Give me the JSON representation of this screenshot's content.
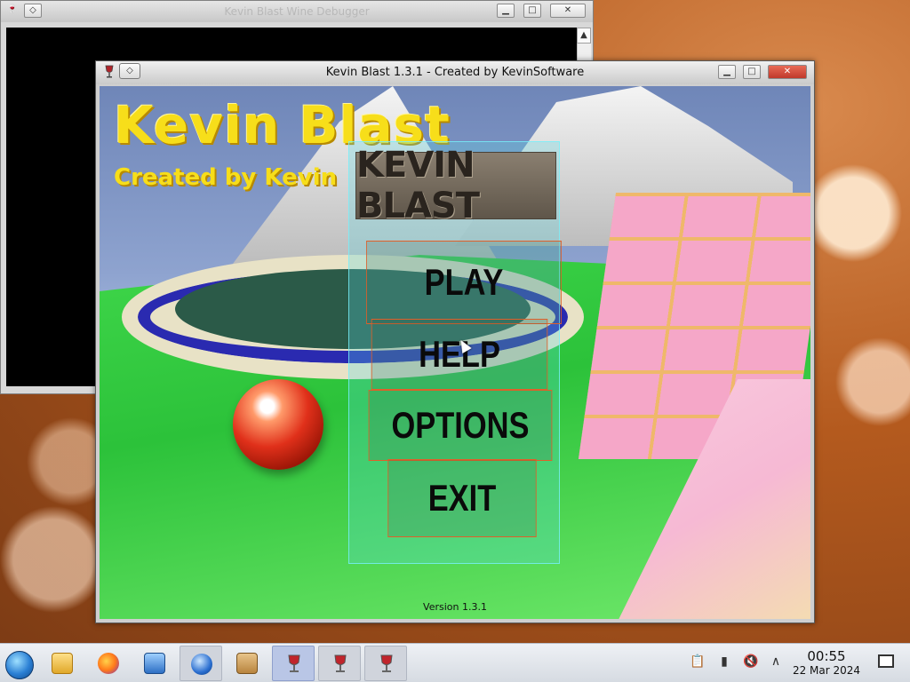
{
  "background_window": {
    "title": "Kevin Blast Wine Debugger",
    "scroll_up_glyph": "▲"
  },
  "main_window": {
    "title": "Kevin Blast 1.3.1 - Created by KevinSoftware",
    "menu_glyph": "◇",
    "minimize_glyph": "▁",
    "maximize_glyph": "□",
    "close_glyph": "✕"
  },
  "game": {
    "logo_title": "Kevin Blast",
    "logo_subtitle": "Created by Kevin",
    "menu_logo": "KEVIN BLAST",
    "menu": {
      "play": "PLAY",
      "help": "HELP",
      "options": "OPTIONS",
      "exit": "EXIT"
    },
    "version": "Version 1.3.1"
  },
  "taskbar": {
    "items": [
      {
        "name": "start-button",
        "icon": "start-orb"
      },
      {
        "name": "file-manager",
        "icon": "folder-icon"
      },
      {
        "name": "firefox",
        "icon": "firefox-icon"
      },
      {
        "name": "control-panel",
        "icon": "control-panel-icon"
      },
      {
        "name": "kevin-blast-installer",
        "icon": "globe-icon"
      },
      {
        "name": "package-manager",
        "icon": "package-icon"
      },
      {
        "name": "wine-app-1",
        "icon": "wine-glass-icon"
      },
      {
        "name": "wine-app-2",
        "icon": "wine-glass-icon"
      },
      {
        "name": "wine-app-3",
        "icon": "wine-glass-icon"
      }
    ],
    "tray": {
      "clock_time": "00:55",
      "clock_date": "22 Mar 2024"
    }
  },
  "colors": {
    "logo_yellow": "#f7de1a",
    "menu_border": "#e0602a",
    "menu_panel_border": "#78f0fa",
    "ball_red": "#e0301a",
    "grass_green": "#2cc23a",
    "tile_pink": "#f5a7c8"
  }
}
